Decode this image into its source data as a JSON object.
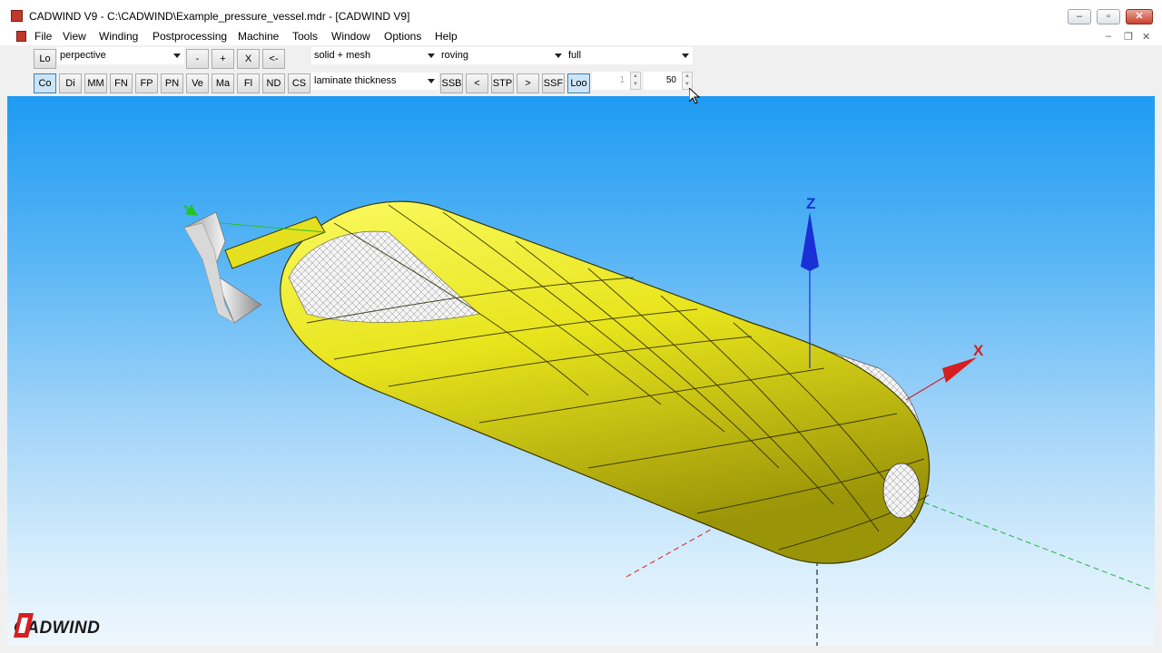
{
  "window": {
    "title": "CADWIND V9  -  C:\\CADWIND\\Example_pressure_vessel.mdr - [CADWIND V9]",
    "minimize": "–",
    "maximize": "▫",
    "close": "✕"
  },
  "menu": {
    "items": [
      "File",
      "View",
      "Winding",
      "Postprocessing",
      "Machine",
      "Tools",
      "Window",
      "Options",
      "Help"
    ],
    "mdi_minimize": "–",
    "mdi_restore": "❐",
    "mdi_close": "✕"
  },
  "toolbar": {
    "row1_buttons": [
      "Lo",
      "-",
      "+",
      "X",
      "<-"
    ],
    "projection": "perpective",
    "display_mode": "solid + mesh",
    "material": "roving",
    "extent": "full",
    "row2_buttons": [
      "Co",
      "Di",
      "MM",
      "FN",
      "FP",
      "PN",
      "Ve",
      "Ma",
      "Fl",
      "ND",
      "CS"
    ],
    "result_type": "laminate thickness",
    "nav_buttons": [
      "SSB",
      "<",
      "STP",
      ">",
      "SSF",
      "Loo"
    ],
    "spin_from": "1",
    "spin_to": "50"
  },
  "viewport": {
    "axis_y": "Y",
    "axis_z": "Z",
    "axis_x": "X",
    "logo": "CADWIND",
    "colors": {
      "background_top": "#1e9bf2",
      "background_bottom": "#eef7fd",
      "vessel": "#e8e41c",
      "axis_x": "#d42020",
      "axis_y": "#22c522",
      "axis_z": "#1a2fd6"
    }
  }
}
